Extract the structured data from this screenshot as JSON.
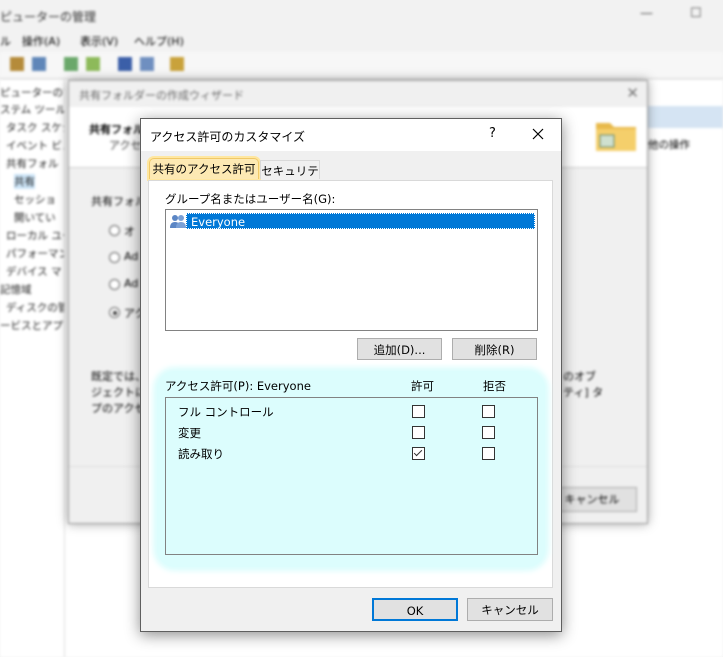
{
  "background": {
    "window_title": "ピューターの管理",
    "menu": [
      "ル",
      "操作(A)",
      "表示(V)",
      "ヘルプ(H)"
    ],
    "tree": [
      "ピューターの管理",
      "ステム ツール",
      "タスク スケジ",
      "イベント ビュ",
      "共有フォル",
      "共有",
      "セッショ",
      "開いてい",
      "ローカル ユー",
      "パフォーマン",
      "デバイス マ",
      "記憶域",
      "ディスクの管",
      "ービスとアプリ"
    ],
    "right_pane": {
      "text": "他の操作"
    },
    "wizard": {
      "title": "共有フォルダーの作成ウィザード",
      "header_title": "共有フォル",
      "header_sub": "アクセ",
      "label": "共有フォル",
      "radios": [
        "オ",
        "Ad",
        "Ad",
        "アク"
      ],
      "body_lines": [
        "既定では、",
        "ジェクトにカ",
        "プのアクセス"
      ],
      "right_lines": [
        "のオブ",
        "ティ] タ"
      ],
      "cancel_label": "キャンセル"
    }
  },
  "dialog": {
    "title": "アクセス許可のカスタマイズ",
    "help": "?",
    "tabs": [
      "共有のアクセス許可",
      "セキュリティ"
    ],
    "group_label": "グループ名またはユーザー名(G):",
    "users": [
      "Everyone"
    ],
    "add_button": "追加(D)...",
    "remove_button": "削除(R)",
    "permissions_label": "アクセス許可(P): Everyone",
    "allow_header": "許可",
    "deny_header": "拒否",
    "permissions": [
      {
        "name": "フル コントロール",
        "allow": false,
        "deny": false
      },
      {
        "name": "変更",
        "allow": false,
        "deny": false
      },
      {
        "name": "読み取り",
        "allow": true,
        "deny": false
      }
    ],
    "ok_button": "OK",
    "cancel_button": "キャンセル"
  },
  "colors": {
    "selection": "#0078d7",
    "tab_highlight": "#fde9b3",
    "permission_highlight": "#dcfdfd"
  }
}
